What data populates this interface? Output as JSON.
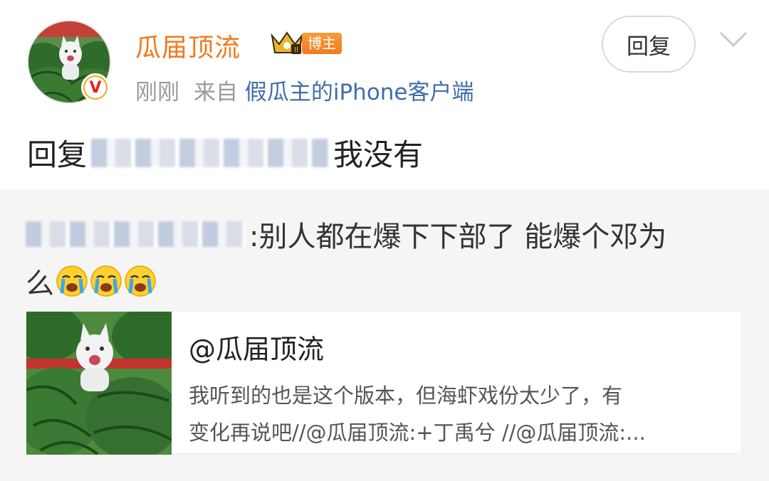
{
  "post": {
    "username": "瓜届顶流",
    "badge_text": "博主",
    "time": "刚刚",
    "from_label": "来自",
    "source": "假瓜主的iPhone客户端",
    "reply_button": "回复",
    "verified_mark": "V"
  },
  "reply": {
    "prefix": "回复",
    "suffix": "我没有"
  },
  "quoted": {
    "line1_text": ":别人都在爆下下部了 能爆个邓为",
    "line2_text": "么"
  },
  "card": {
    "title": "@瓜届顶流",
    "line1": "我听到的也是这个版本，但海虾戏份太少了，有",
    "line2": "变化再说吧//@瓜届顶流:+丁禹兮 //@瓜届顶流:..."
  },
  "colors": {
    "username": "#f3781e",
    "link": "#3f6dab",
    "meta_gray": "#9a9a9a",
    "quote_bg": "#f5f5f5"
  }
}
